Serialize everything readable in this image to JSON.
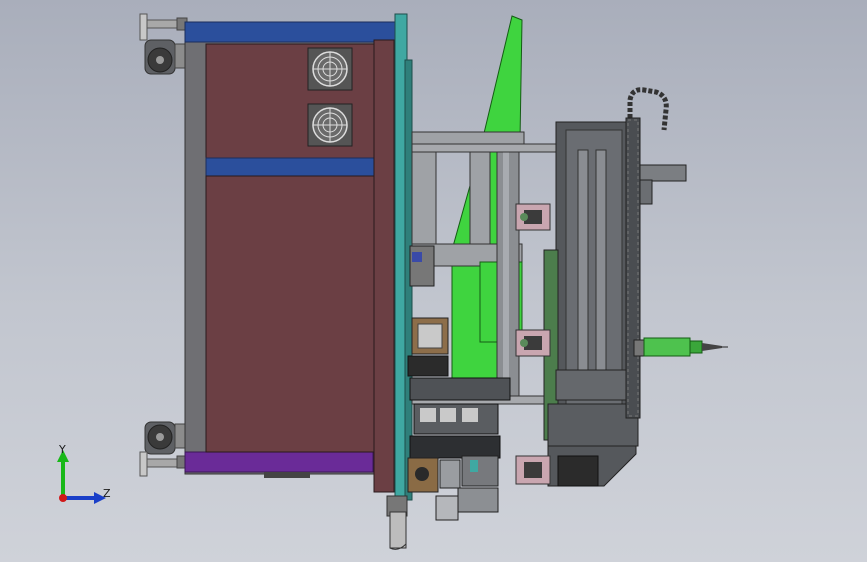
{
  "viewport": {
    "background_top": "#a9aebb",
    "background_bottom": "#cfd2d9"
  },
  "triad": {
    "y_label": "Y",
    "z_label": "Z",
    "y_color": "#18b818",
    "z_color": "#1a3fc8",
    "origin_color": "#d01818"
  },
  "colors": {
    "cabinet_panel": "#6b3f44",
    "frame_blue": "#2b4f9c",
    "frame_purple": "#6a2b98",
    "frame_grey": "#6f6f73",
    "plate_teal": "#3fa8a2",
    "green_plate": "#3fd43f",
    "dark_metal": "#55585c",
    "light_metal": "#9fa2a6",
    "spindle_green": "#4ec24e"
  },
  "icons": {
    "fan_upper": "fan-icon",
    "fan_lower": "fan-icon",
    "caster_top": "caster-wheel-icon",
    "caster_bottom": "caster-wheel-icon",
    "leveling_feet": "leveling-foot-icon",
    "cable_chain": "cable-chain-icon"
  }
}
